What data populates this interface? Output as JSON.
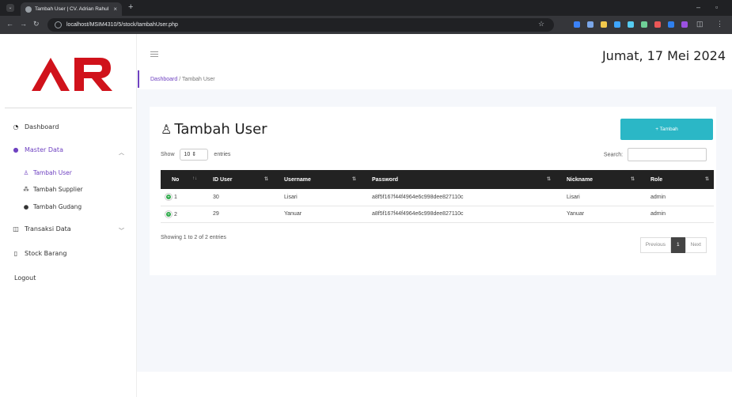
{
  "browser": {
    "tab_title": "Tambah User | CV. Adrian Rahul",
    "url": "localhost/MSIM4310/5/stock/tambahUser.php"
  },
  "sidebar": {
    "logo_text": "AR",
    "items": [
      {
        "label": "Dashboard",
        "icon": "dashboard-icon"
      },
      {
        "label": "Master Data",
        "icon": "info-circle-icon"
      },
      {
        "label": "Transaksi Data",
        "icon": "book-icon"
      },
      {
        "label": "Stock Barang",
        "icon": "document-icon"
      },
      {
        "label": "Logout"
      }
    ],
    "subitems": [
      {
        "label": "Tambah User",
        "icon": "user-icon"
      },
      {
        "label": "Tambah Supplier",
        "icon": "users-icon"
      },
      {
        "label": "Tambah Gudang",
        "icon": "dot-icon"
      }
    ]
  },
  "header": {
    "date": "Jumat, 17 Mei 2024",
    "breadcrumb": {
      "home": "Dashboard",
      "separator": "/",
      "current": "Tambah User"
    }
  },
  "card": {
    "title": "Tambah User",
    "add_button": "+ Tambah",
    "show_label": "Show",
    "entries_value": "10",
    "entries_label": "entries",
    "search_label": "Search:",
    "columns": [
      "No",
      "ID User",
      "Username",
      "Password",
      "Nickname",
      "Role"
    ],
    "rows": [
      {
        "no": "1",
        "id": "30",
        "username": "Lisari",
        "password": "a8f5f167f44f4964e6c998dee827110c",
        "nickname": "Lisari",
        "role": "admin"
      },
      {
        "no": "2",
        "id": "29",
        "username": "Yanuar",
        "password": "a8f5f167f44f4964e6c998dee827110c",
        "nickname": "Yanuar",
        "role": "admin"
      }
    ],
    "info": "Showing 1 to 2 of 2 entries",
    "pager": {
      "prev": "Previous",
      "page": "1",
      "next": "Next"
    }
  },
  "colors": {
    "accent": "#6f42c1",
    "button": "#2bb7c6",
    "table_header": "#222222",
    "logo_red": "#d0121b"
  }
}
